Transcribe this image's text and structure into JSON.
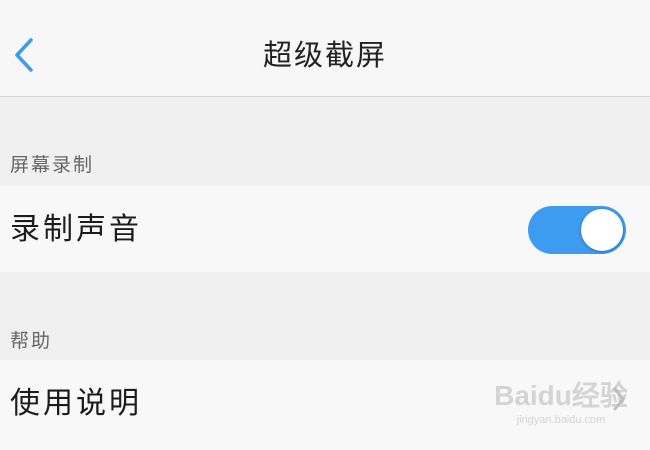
{
  "header": {
    "title": "超级截屏",
    "back_icon": "chevron-left-icon"
  },
  "sections": {
    "recording": {
      "label": "屏幕录制",
      "record_audio_label": "录制声音",
      "record_audio_enabled": true
    },
    "help": {
      "label": "帮助",
      "instructions_label": "使用说明",
      "chevron_icon": "chevron-right-icon"
    }
  },
  "colors": {
    "accent": "#3d9bf0",
    "background": "#f0f0f0",
    "row_background": "#f8f8f8"
  },
  "watermark": {
    "logo_text": "Baidu经验",
    "sub_text": "jingyan.baidu.com"
  }
}
